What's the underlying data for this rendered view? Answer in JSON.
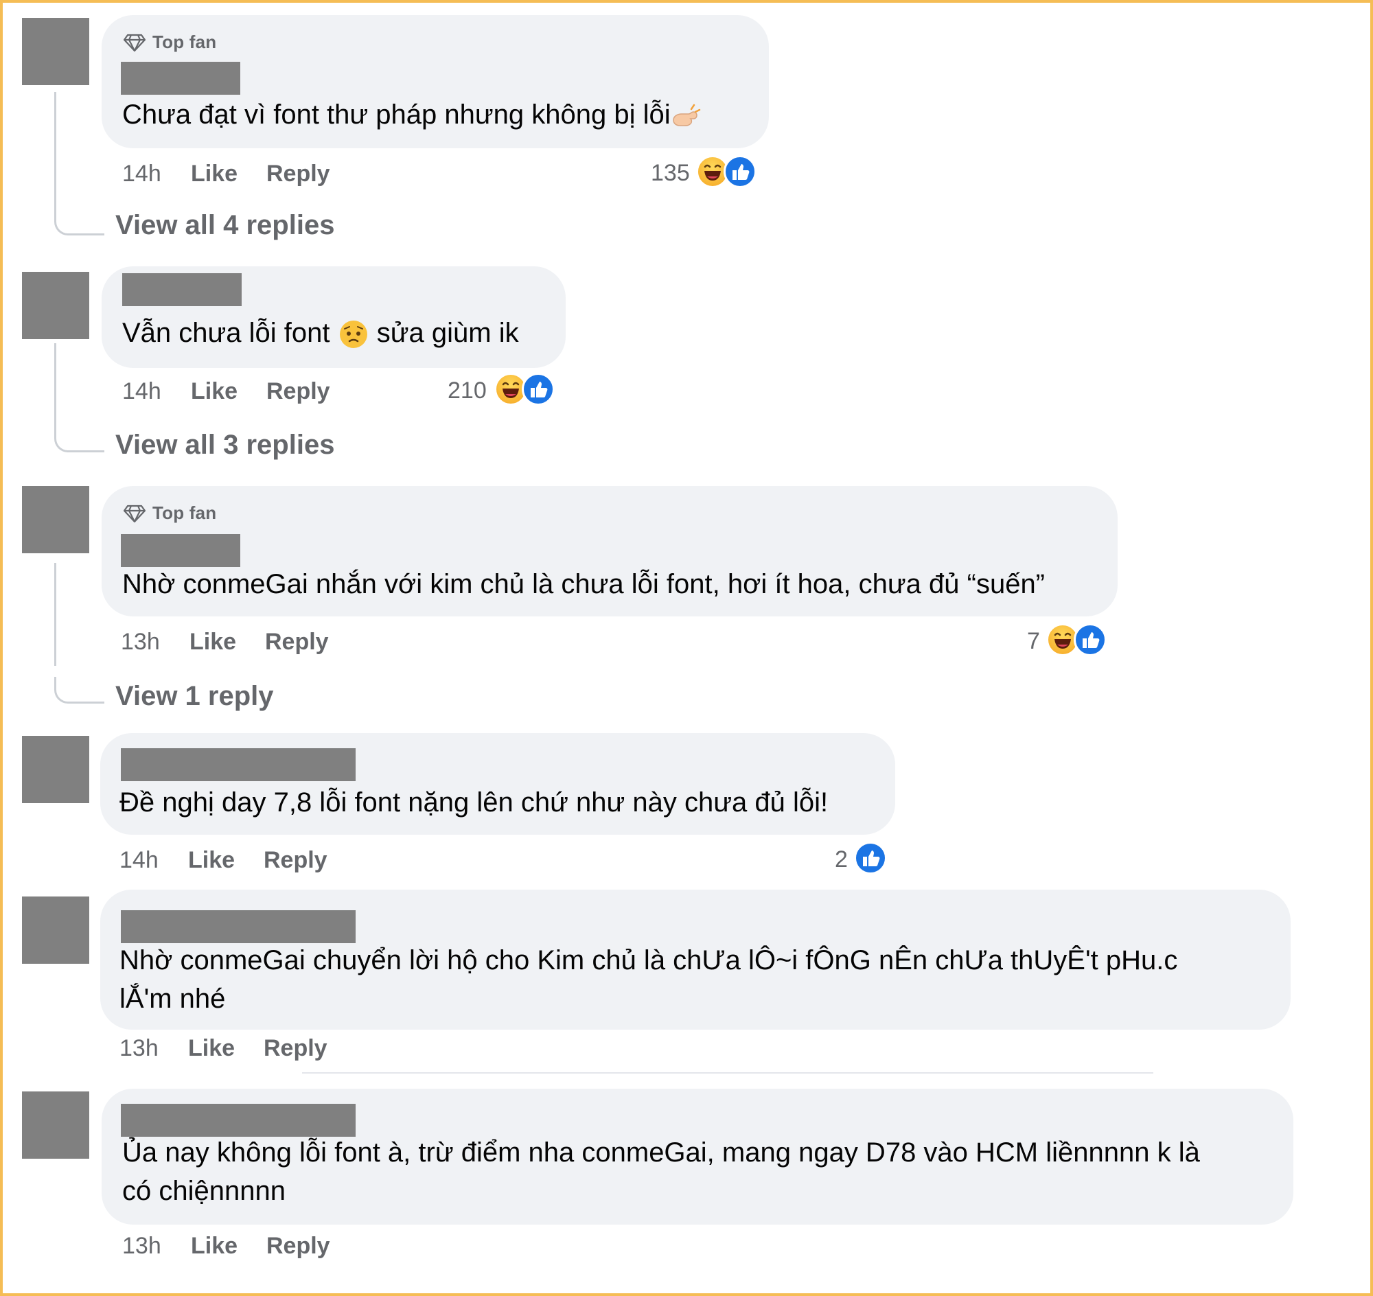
{
  "comments": [
    {
      "badge": "Top fan",
      "text": "Chưa đạt vì font thư pháp nhưng không bị lỗi",
      "time": "14h",
      "like_label": "Like",
      "reply_label": "Reply",
      "reaction_count": "135",
      "reactions": [
        "haha",
        "like"
      ],
      "view_replies": "View all 4 replies"
    },
    {
      "text": "Vẫn chưa lỗi font",
      "text_after_emoji": "sửa giùm ik",
      "time": "14h",
      "like_label": "Like",
      "reply_label": "Reply",
      "reaction_count": "210",
      "reactions": [
        "haha",
        "like"
      ],
      "view_replies": "View all 3 replies"
    },
    {
      "badge": "Top fan",
      "text": "Nhờ conmeGai nhắn với kim chủ là chưa lỗi font, hơi ít hoa, chưa đủ “suến”",
      "time": "13h",
      "like_label": "Like",
      "reply_label": "Reply",
      "reaction_count": "7",
      "reactions": [
        "haha",
        "like"
      ],
      "view_replies": "View 1 reply"
    },
    {
      "text": "Đề nghị day 7,8 lỗi font nặng lên chứ như này chưa đủ lỗi!",
      "time": "14h",
      "like_label": "Like",
      "reply_label": "Reply",
      "reaction_count": "2",
      "reactions": [
        "like"
      ]
    },
    {
      "text_line1": "Nhờ conmeGai chuyển lời hộ cho Kim chủ là chƯa lÔ~i fÔnG nÊn chƯa thUyÊ't pHu.c",
      "text_line2": "lẮ'm nhé",
      "time": "13h",
      "like_label": "Like",
      "reply_label": "Reply"
    },
    {
      "text_line1": "Ủa nay không lỗi font à, trừ điểm nha conmeGai, mang ngay D78 vào HCM liềnnnnn k là",
      "text_line2": "có chiệnnnnn",
      "time": "13h",
      "like_label": "Like",
      "reply_label": "Reply"
    }
  ],
  "colors": {
    "frame": "#f5bd55",
    "bubble": "#f0f2f5",
    "meta_text": "#65676b",
    "like_blue": "#1b74e4",
    "haha_yellow": "#f5a623"
  }
}
